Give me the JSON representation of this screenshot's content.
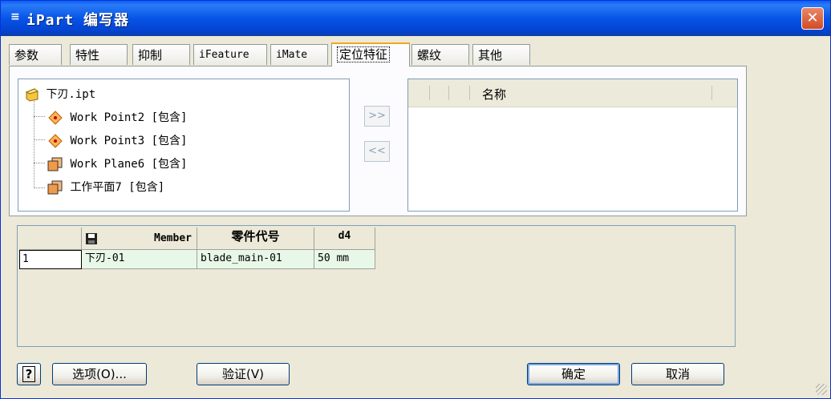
{
  "window": {
    "title": "iPart 编写器",
    "close_glyph": "✕"
  },
  "tabs": [
    {
      "label": "参数"
    },
    {
      "label": "特性"
    },
    {
      "label": "抑制"
    },
    {
      "label": "iFeature"
    },
    {
      "label": "iMate"
    },
    {
      "label": "定位特征"
    },
    {
      "label": "螺纹"
    },
    {
      "label": "其他"
    }
  ],
  "active_tab": "定位特征",
  "tree": {
    "root": "下刃.ipt",
    "items": [
      {
        "label": "Work Point2 [包含]",
        "icon": "work-point-icon"
      },
      {
        "label": "Work Point3 [包含]",
        "icon": "work-point-icon"
      },
      {
        "label": "Work Plane6 [包含]",
        "icon": "work-plane-icon"
      },
      {
        "label": "工作平面7 [包含]",
        "icon": "work-plane-icon"
      }
    ]
  },
  "move_buttons": {
    "add": ">>",
    "remove": "<<"
  },
  "right_list": {
    "header": "名称"
  },
  "table": {
    "headers": [
      "Member",
      "零件代号",
      "d4"
    ],
    "rows": [
      {
        "index": "1",
        "member": "下刃-01",
        "part_number": "blade_main-01",
        "d4": "50 mm"
      }
    ]
  },
  "buttons": {
    "help": "?",
    "options": "选项(O)...",
    "verify": "验证(V)",
    "ok": "确定",
    "cancel": "取消"
  },
  "colors": {
    "titlebar": "#0754e6",
    "dialog_bg": "#ece9d8",
    "row_bg": "#e8f8e8",
    "active_tab_accent": "#f0a81c"
  }
}
